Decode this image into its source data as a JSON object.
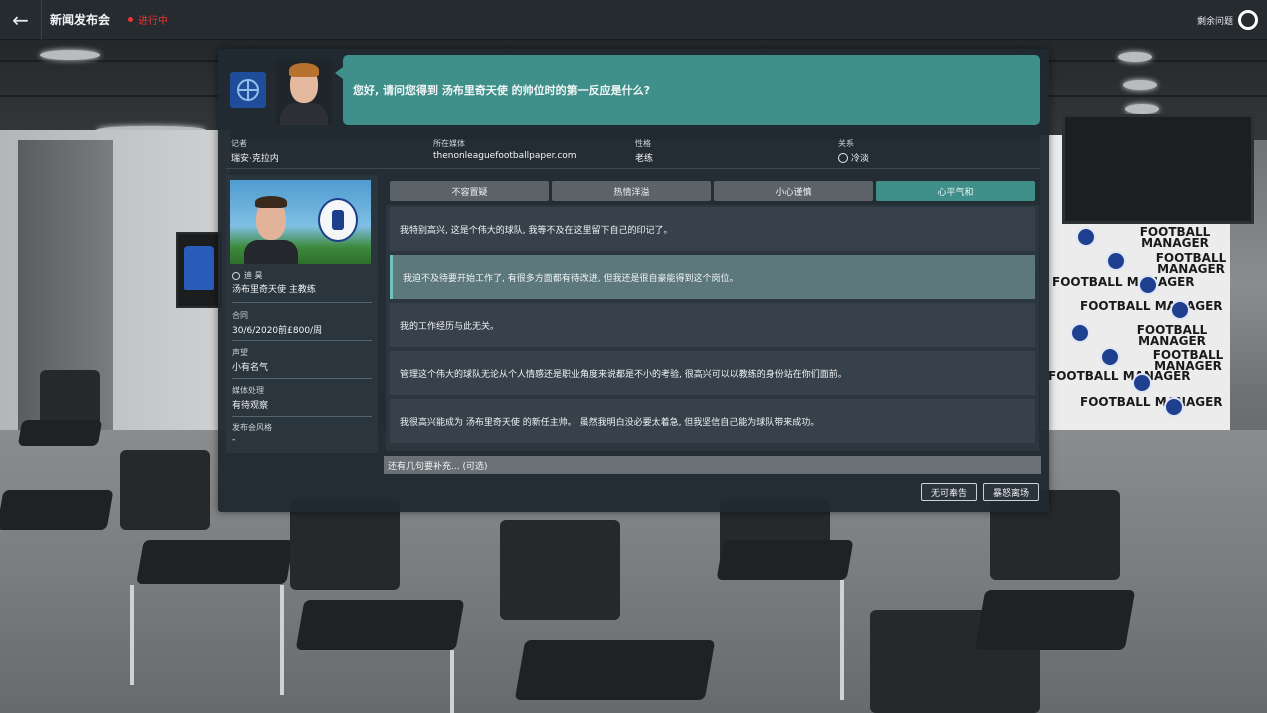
{
  "topbar": {
    "back_icon": "arrow-left-icon",
    "title": "新闻发布会",
    "status": "进行中",
    "status_color": "#e8362f",
    "remaining_label": "剩余问题",
    "remaining_icon": "progress-ring-icon"
  },
  "question": {
    "text": "您好, 请问您得到 汤布里奇天使 的帅位时的第一反应是什么?",
    "bubble_color": "#3f8f8a"
  },
  "reporter": {
    "label": "记者",
    "name": "瑞安·克拉内",
    "media_label": "所在媒体",
    "media": "thenonleaguefootballpaper.com",
    "personality_label": "性格",
    "personality": "老练",
    "relationship_label": "关系",
    "relationship": "冷淡",
    "relationship_icon": "cold-icon"
  },
  "manager": {
    "name": "迪 昊",
    "role": "汤布里奇天使 主教练",
    "contract_label": "合同",
    "contract": "30/6/2020前£800/周",
    "reputation_label": "声望",
    "reputation": "小有名气",
    "media_handling_label": "媒体处理",
    "media_handling": "有待观察",
    "press_style_label": "发布会风格",
    "press_style": "-"
  },
  "tones": [
    {
      "label": "不容置疑",
      "active": false
    },
    {
      "label": "热情洋溢",
      "active": false
    },
    {
      "label": "小心谨慎",
      "active": false
    },
    {
      "label": "心平气和",
      "active": true
    }
  ],
  "answers": [
    {
      "text": "我特别高兴, 这是个伟大的球队, 我等不及在这里留下自己的印记了。",
      "selected": false
    },
    {
      "text": "我迫不及待要开始工作了, 有很多方面都有待改进, 但我还是很自豪能得到这个岗位。",
      "selected": true
    },
    {
      "text": "我的工作经历与此无关。",
      "selected": false
    },
    {
      "text": "管理这个伟大的球队无论从个人情感还是职业角度来说都是不小的考验, 很高兴可以以教练的身份站在你们面前。",
      "selected": false
    },
    {
      "text": "我很高兴能成为 汤布里奇天使 的新任主帅。 虽然我明白没必要太着急, 但我坚信自己能为球队带来成功。",
      "selected": false
    }
  ],
  "extra": {
    "placeholder": "还有几句要补充... (可选)"
  },
  "actions": {
    "no_comment": "无可奉告",
    "storm_off": "暴怒离场"
  },
  "scene": {
    "backdrop_logo": "FOOTBALL MANAGER"
  }
}
